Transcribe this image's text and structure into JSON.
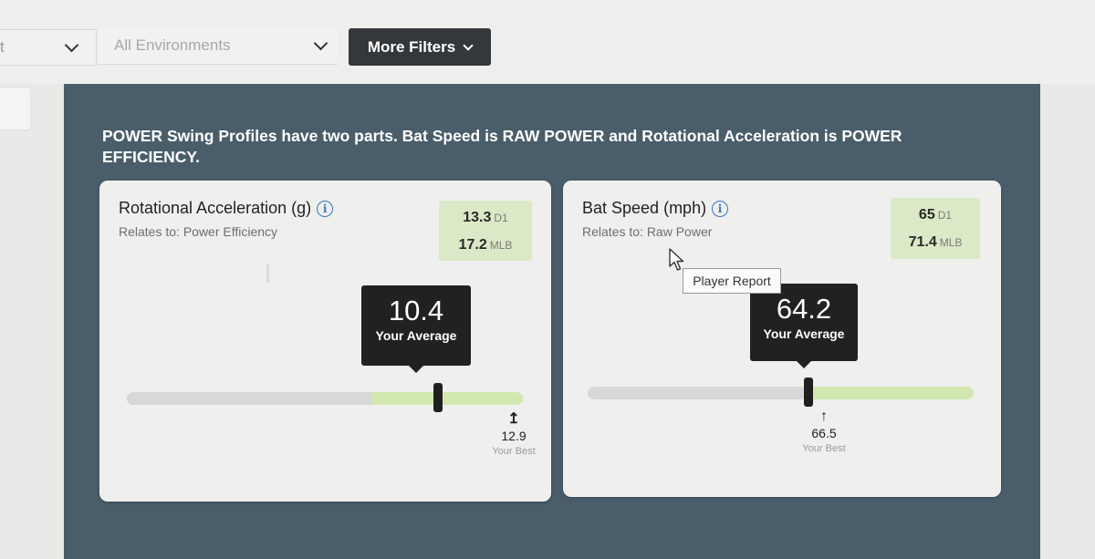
{
  "filters": {
    "partial_select_text": "t",
    "environment_select": {
      "value": "All Environments"
    },
    "more_filters_label": "More Filters"
  },
  "panel": {
    "intro": "POWER Swing Profiles have two parts. Bat Speed is RAW POWER and Rotational Acceleration is POWER EFFICIENCY."
  },
  "cards": [
    {
      "title": "Rotational Acceleration (g)",
      "subtitle": "Relates to: Power Efficiency",
      "benchmarks": [
        {
          "value": "13.3",
          "tag": "D1"
        },
        {
          "value": "17.2",
          "tag": "MLB"
        }
      ],
      "average": {
        "value": "10.4",
        "label": "Your Average"
      },
      "best": {
        "value": "12.9",
        "label": "Your Best"
      }
    },
    {
      "title": "Bat Speed (mph)",
      "subtitle": "Relates to: Raw Power",
      "benchmarks": [
        {
          "value": "65",
          "tag": "D1"
        },
        {
          "value": "71.4",
          "tag": "MLB"
        }
      ],
      "average": {
        "value": "64.2",
        "label": "Your Average"
      },
      "best": {
        "value": "66.5",
        "label": "Your Best"
      }
    }
  ],
  "tooltip": {
    "text": "Player Report"
  },
  "icons": {
    "info": "info-circle-icon",
    "chevron": "chevron-down-icon",
    "best_arrow": "arrow-up-icon",
    "cursor": "mouse-pointer-icon"
  },
  "colors": {
    "panel_bg": "#4a5d6a",
    "button_bg": "#35383a",
    "benchmark_bg": "#dbe9c6",
    "track_green": "#d3e8b0",
    "info_blue": "#3a78c2"
  }
}
